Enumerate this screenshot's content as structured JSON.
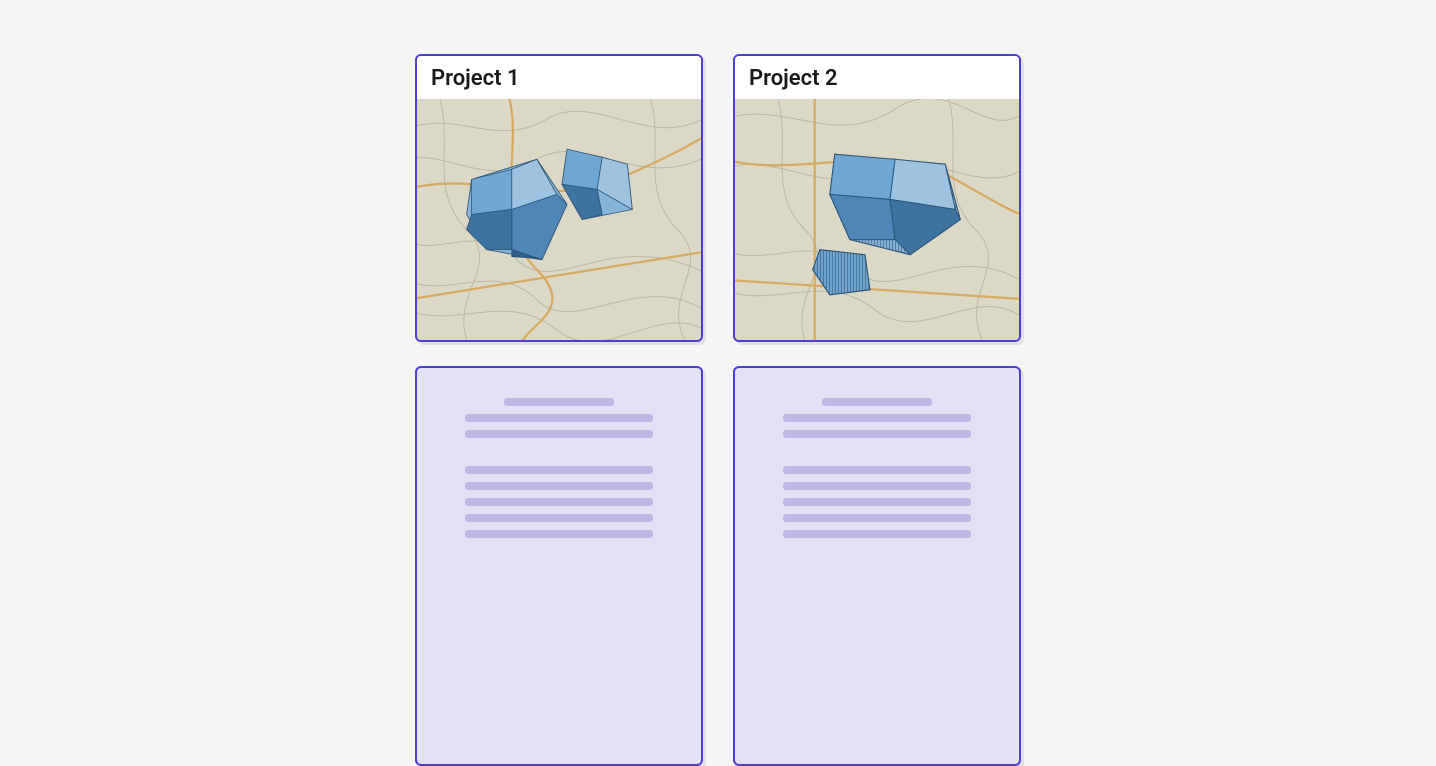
{
  "projects": [
    {
      "title": "Project 1"
    },
    {
      "title": "Project 2"
    }
  ],
  "colors": {
    "card_border": "#4B3FD8",
    "list_bg": "#E3E1F6",
    "skeleton": "#BDB8E6",
    "map_land": "#dcd8c6",
    "map_road": "#d8a657",
    "parcel_light": "#9ec3e0",
    "parcel_mid": "#6fa7d2",
    "parcel_dark": "#3e729f"
  },
  "skeleton_groups": [
    [
      "short",
      "long",
      "long"
    ],
    [
      "long",
      "long",
      "long",
      "long",
      "long"
    ]
  ]
}
